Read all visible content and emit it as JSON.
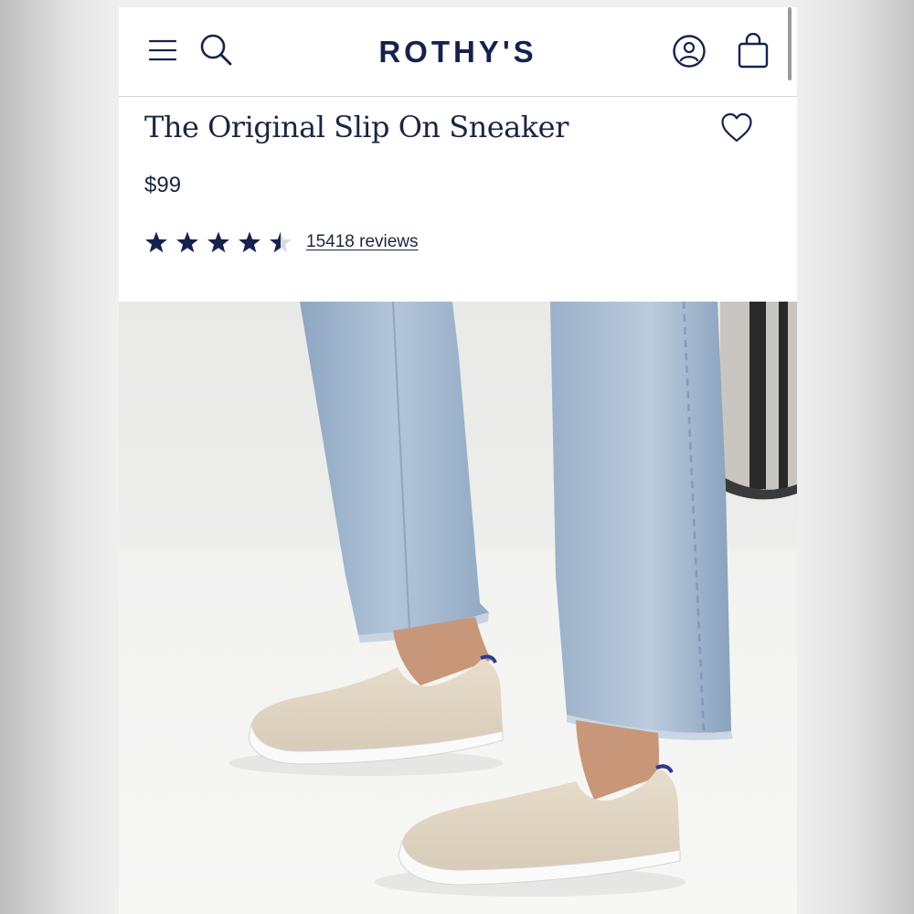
{
  "header": {
    "logo_text": "ROTHY'S",
    "icons": [
      "menu-icon",
      "search-icon",
      "account-icon",
      "shopping-bag-icon"
    ],
    "brand_color": "#14224d"
  },
  "product": {
    "title": "The Original Slip On Sneaker",
    "price": "$99",
    "rating": 4.5,
    "rating_max": 5,
    "reviews_label": "15418 reviews",
    "wishlist_icon": "heart-icon"
  },
  "image": {
    "subject": "product-photo-slip-on-sneakers"
  }
}
